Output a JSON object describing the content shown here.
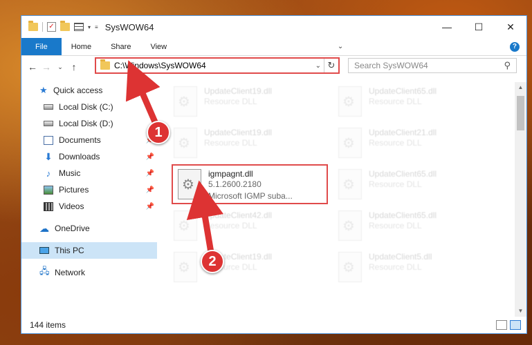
{
  "window": {
    "title": "SysWOW64"
  },
  "ribbon": {
    "tabs": [
      "File",
      "Home",
      "Share",
      "View"
    ],
    "help": "?"
  },
  "address": {
    "path": "C:\\Windows\\SysWOW64"
  },
  "search": {
    "placeholder": "Search SysWOW64"
  },
  "sidebar": {
    "items": [
      {
        "label": "Quick access",
        "icon": "star-icon"
      },
      {
        "label": "Local Disk (C:)",
        "icon": "drive-icon"
      },
      {
        "label": "Local Disk (D:)",
        "icon": "drive-icon"
      },
      {
        "label": "Documents",
        "icon": "documents-icon"
      },
      {
        "label": "Downloads",
        "icon": "download-icon"
      },
      {
        "label": "Music",
        "icon": "music-icon"
      },
      {
        "label": "Pictures",
        "icon": "pictures-icon"
      },
      {
        "label": "Videos",
        "icon": "videos-icon"
      },
      {
        "label": "OneDrive",
        "icon": "cloud-icon"
      },
      {
        "label": "This PC",
        "icon": "computer-icon"
      },
      {
        "label": "Network",
        "icon": "network-icon"
      }
    ]
  },
  "files": [
    {
      "name": "UpdateClient19.dll",
      "sub1": "Resource DLL",
      "sub2": ""
    },
    {
      "name": "UpdateClient65.dll",
      "sub1": "Resource DLL",
      "sub2": ""
    },
    {
      "name": "UpdateClient19.dll",
      "sub1": "Resource DLL",
      "sub2": ""
    },
    {
      "name": "UpdateClient21.dll",
      "sub1": "Resource DLL",
      "sub2": ""
    },
    {
      "name": "igmpagnt.dll",
      "sub1": "5.1.2600.2180",
      "sub2": "Microsoft IGMP suba..."
    },
    {
      "name": "UpdateClient65.dll",
      "sub1": "Resource DLL",
      "sub2": ""
    },
    {
      "name": "UpdateClient42.dll",
      "sub1": "Resource DLL",
      "sub2": ""
    },
    {
      "name": "UpdateClient65.dll",
      "sub1": "Resource DLL",
      "sub2": ""
    },
    {
      "name": "UpdateClient19.dll",
      "sub1": "Resource DLL",
      "sub2": ""
    },
    {
      "name": "UpdateClient5.dll",
      "sub1": "Resource DLL",
      "sub2": ""
    }
  ],
  "status": {
    "count": "144 items"
  },
  "callouts": [
    "1",
    "2"
  ],
  "colors": {
    "accent": "#1979ca",
    "highlight": "#e04a4a",
    "selected": "#cce4f7"
  }
}
